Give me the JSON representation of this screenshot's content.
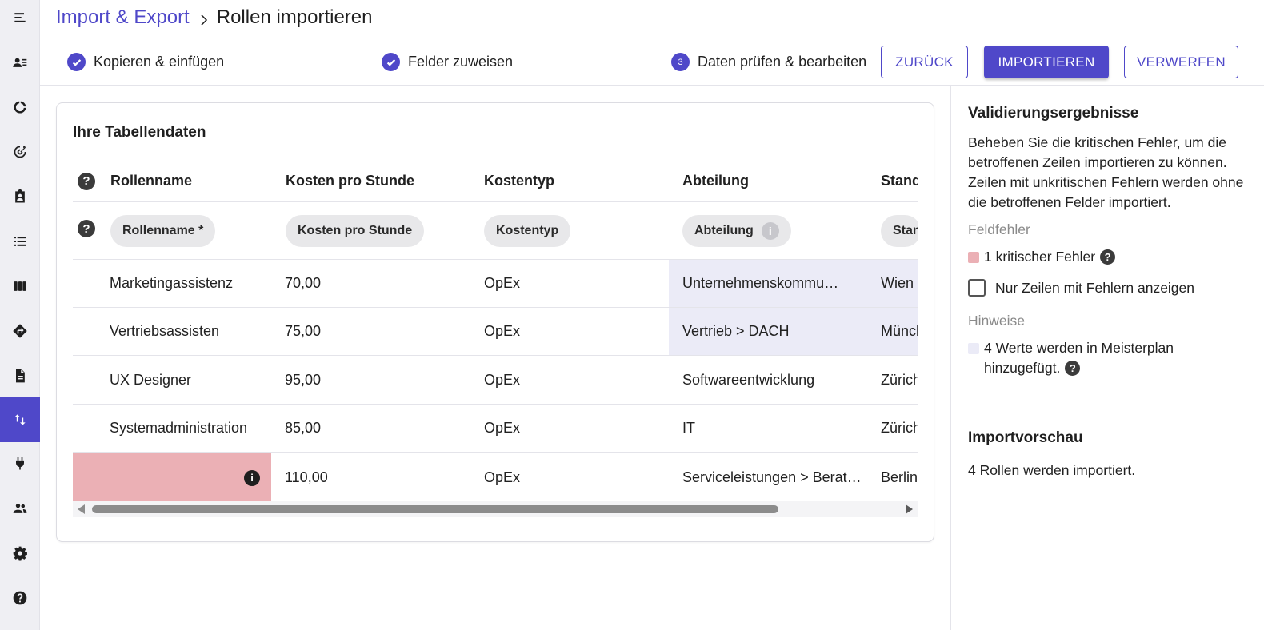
{
  "sidebar": {
    "items": [
      {
        "name": "menu-icon"
      },
      {
        "name": "contacts-icon"
      },
      {
        "name": "donut-chart-icon"
      },
      {
        "name": "target-icon"
      },
      {
        "name": "clipboard-user-icon"
      },
      {
        "name": "list-icon"
      },
      {
        "name": "columns-icon"
      },
      {
        "name": "directions-icon"
      },
      {
        "name": "document-icon"
      },
      {
        "name": "import-export-icon",
        "active": true
      },
      {
        "name": "plug-icon"
      },
      {
        "name": "people-icon"
      },
      {
        "name": "gear-icon"
      },
      {
        "name": "help-icon"
      }
    ]
  },
  "breadcrumb": {
    "parent": "Import & Export",
    "current": "Rollen importieren"
  },
  "stepper": {
    "steps": [
      {
        "label": "Kopieren & einfügen",
        "state": "done"
      },
      {
        "label": "Felder zuweisen",
        "state": "done"
      },
      {
        "label": "Daten prüfen & bearbeiten",
        "state": "current",
        "number": "3"
      }
    ]
  },
  "actions": {
    "back": "ZURÜCK",
    "import": "IMPORTIEREN",
    "discard": "VERWERFEN"
  },
  "table_card": {
    "title": "Ihre Tabellendaten",
    "headers": [
      "Rollenname",
      "Kosten pro Stunde",
      "Kostentyp",
      "Abteilung",
      "Stand"
    ],
    "mapping": [
      "Rollenname *",
      "Kosten pro Stunde",
      "Kostentyp",
      "Abteilung",
      "Stan"
    ],
    "help_symbol": "?",
    "info_symbol": "i",
    "rows": [
      {
        "cells": [
          "Marketingassistenz",
          "70,00",
          "OpEx",
          "Unternehmenskommu…",
          "Wien"
        ],
        "hint_col": 3,
        "hint_col2": 4
      },
      {
        "cells": [
          "Vertriebsassisten",
          "75,00",
          "OpEx",
          "Vertrieb > DACH",
          "Münch"
        ],
        "hint_col": 3,
        "hint_col2": 4
      },
      {
        "cells": [
          "UX Designer",
          "95,00",
          "OpEx",
          "Softwareentwicklung",
          "Zürich"
        ]
      },
      {
        "cells": [
          "Systemadministration",
          "85,00",
          "OpEx",
          "IT",
          "Zürich"
        ]
      },
      {
        "cells": [
          "",
          "110,00",
          "OpEx",
          "Serviceleistungen > Berat…",
          "Berlin"
        ],
        "error_col": 0
      }
    ]
  },
  "validation": {
    "title": "Validierungsergebnisse",
    "description": "Beheben Sie die kritischen Fehler, um die betroffenen Zeilen importieren zu können. Zeilen mit unkritischen Fehlern werden ohne die betroffenen Felder importiert.",
    "field_errors_label": "Feldfehler",
    "critical_errors": "1 kritischer Fehler",
    "only_errors_checkbox": "Nur Zeilen mit Fehlern anzeigen",
    "hints_label": "Hinweise",
    "hints_text_line1": "4 Werte werden in Meisterplan",
    "hints_text_line2": "hinzugefügt.",
    "error_color": "#ebb0b5",
    "hint_color": "#ebebf7"
  },
  "import_preview": {
    "title": "Importvorschau",
    "text": "4 Rollen werden importiert."
  },
  "colors": {
    "accent": "#4f48c9"
  }
}
